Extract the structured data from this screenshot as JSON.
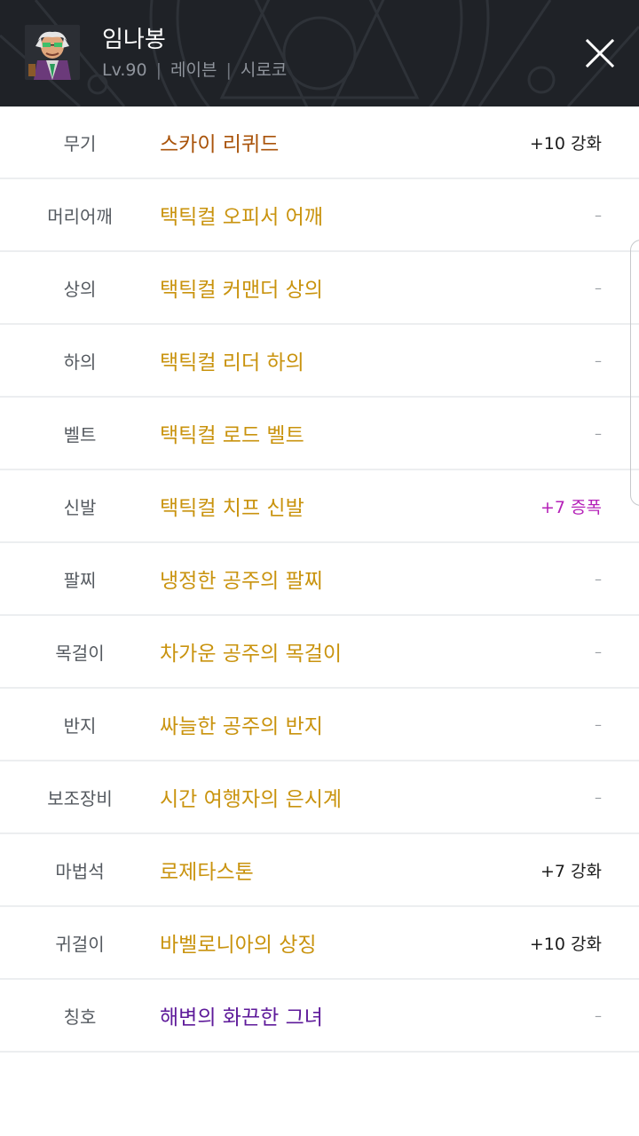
{
  "header": {
    "character_name": "임나봉",
    "level": "Lv.90",
    "job": "레이븐",
    "server": "시로코",
    "separator": "|",
    "close_icon": "close-icon",
    "avatar_icon": "character-avatar"
  },
  "colors": {
    "header_bg": "#1f2227",
    "item_gold": "#c9930e",
    "item_brown": "#a9530a",
    "item_purple": "#5e1a9a",
    "enhance_black": "#1c1c1c",
    "amplify_magenta": "#b521b8",
    "dash_gray": "#9a9ea4"
  },
  "equipment": [
    {
      "slot": "무기",
      "item": "스카이 리퀴드",
      "item_color": "#a9530a",
      "extra": "+10 강화",
      "extra_color": "#1c1c1c"
    },
    {
      "slot": "머리어깨",
      "item": "택틱컬 오피서 어깨",
      "item_color": "#c9930e",
      "extra": "–",
      "extra_color": "#9a9ea4"
    },
    {
      "slot": "상의",
      "item": "택틱컬 커맨더 상의",
      "item_color": "#c9930e",
      "extra": "–",
      "extra_color": "#9a9ea4"
    },
    {
      "slot": "하의",
      "item": "택틱컬 리더 하의",
      "item_color": "#c9930e",
      "extra": "–",
      "extra_color": "#9a9ea4"
    },
    {
      "slot": "벨트",
      "item": "택틱컬 로드 벨트",
      "item_color": "#c9930e",
      "extra": "–",
      "extra_color": "#9a9ea4"
    },
    {
      "slot": "신발",
      "item": "택틱컬 치프 신발",
      "item_color": "#c9930e",
      "extra": "+7 증폭",
      "extra_color": "#b521b8"
    },
    {
      "slot": "팔찌",
      "item": "냉정한 공주의 팔찌",
      "item_color": "#c9930e",
      "extra": "–",
      "extra_color": "#9a9ea4"
    },
    {
      "slot": "목걸이",
      "item": "차가운 공주의 목걸이",
      "item_color": "#c9930e",
      "extra": "–",
      "extra_color": "#9a9ea4"
    },
    {
      "slot": "반지",
      "item": "싸늘한 공주의 반지",
      "item_color": "#c9930e",
      "extra": "–",
      "extra_color": "#9a9ea4"
    },
    {
      "slot": "보조장비",
      "item": "시간 여행자의 은시계",
      "item_color": "#c9930e",
      "extra": "–",
      "extra_color": "#9a9ea4"
    },
    {
      "slot": "마법석",
      "item": "로제타스톤",
      "item_color": "#c9930e",
      "extra": "+7 강화",
      "extra_color": "#1c1c1c"
    },
    {
      "slot": "귀걸이",
      "item": "바벨로니아의 상징",
      "item_color": "#c9930e",
      "extra": "+10 강화",
      "extra_color": "#1c1c1c"
    },
    {
      "slot": "칭호",
      "item": "해변의 화끈한 그녀",
      "item_color": "#5e1a9a",
      "extra": "–",
      "extra_color": "#9a9ea4"
    }
  ]
}
